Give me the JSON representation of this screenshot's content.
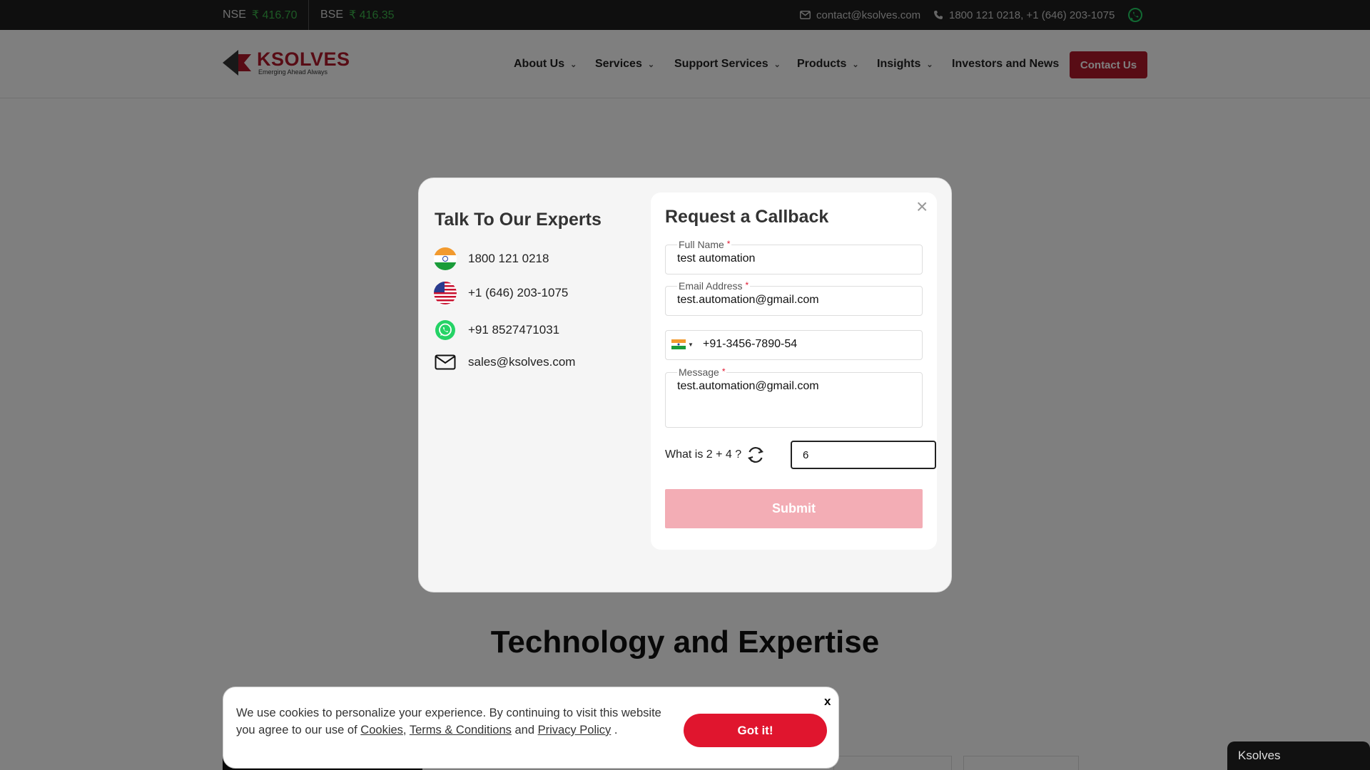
{
  "topbar": {
    "nse_label": "NSE",
    "nse_price": "₹ 416.70",
    "bse_label": "BSE",
    "bse_price": "₹ 416.35",
    "email": "contact@ksolves.com",
    "phones": "1800 121 0218,  +1 (646) 203-1075"
  },
  "header": {
    "logo_name": "KSOLVES",
    "logo_tagline": "Emerging Ahead Always",
    "nav": [
      {
        "label": "About Us"
      },
      {
        "label": "Services"
      },
      {
        "label": "Support Services"
      },
      {
        "label": "Products"
      },
      {
        "label": "Insights"
      },
      {
        "label": "Investors and News"
      }
    ],
    "contact_button": "Contact Us"
  },
  "page": {
    "heading": "Technology and Expertise"
  },
  "modal": {
    "experts_title": "Talk To Our Experts",
    "experts": [
      {
        "icon": "india-flag-icon",
        "text": "1800 121 0218"
      },
      {
        "icon": "us-flag-icon",
        "text": "+1 (646) 203-1075"
      },
      {
        "icon": "whatsapp-icon",
        "text": "+91 8527471031"
      },
      {
        "icon": "mail-icon",
        "text": "sales@ksolves.com"
      }
    ],
    "form": {
      "title": "Request a Callback",
      "close": "×",
      "full_name_label": "Full Name",
      "full_name_value": "test automation",
      "email_label": "Email Address",
      "email_value": "test.automation@gmail.com",
      "phone_value": "+91-3456-7890-54",
      "message_label": "Message",
      "message_value": "test.automation@gmail.com",
      "required_mark": "*",
      "captcha_question": "What is 2 + 4 ?",
      "captcha_answer": "6",
      "submit_label": "Submit"
    }
  },
  "cookie": {
    "text_1": "We use cookies to personalize your experience. By continuing to visit this website you agree to our use of",
    "cookies_link": "Cookies",
    "comma": ",",
    "terms_link": "Terms & Conditions",
    "and": "and",
    "privacy_link": "Privacy Policy",
    "period": ".",
    "close": "x",
    "button": "Got it!"
  },
  "chat": {
    "label": "Ksolves"
  },
  "colors": {
    "brand_red": "#b0192b",
    "accent_red": "#e0152e",
    "submit_disabled": "#f3adb5",
    "ticker_green": "#3bb34a"
  }
}
